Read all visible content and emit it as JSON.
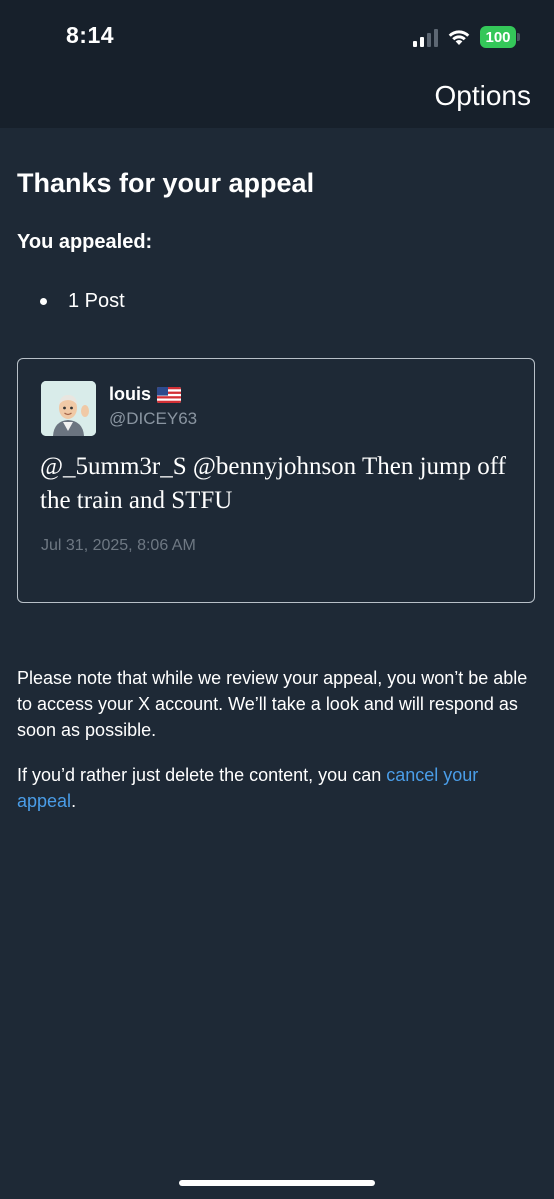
{
  "status_bar": {
    "time": "8:14",
    "battery": "100",
    "battery_color": "#34c759"
  },
  "header": {
    "options_label": "Options"
  },
  "page": {
    "title": "Thanks for your appeal",
    "appealed_label": "You appealed:",
    "appealed_items": [
      "1 Post"
    ]
  },
  "post": {
    "author_name": "louis",
    "author_flag_icon": "us-flag-icon",
    "author_handle": "@DICEY63",
    "text": "@_5umm3r_S @bennyjohnson Then jump off the train and STFU",
    "date": "Jul 31, 2025, 8:06 AM"
  },
  "notice": {
    "text": "Please note that while we review your appeal, you won’t be able to access your X account. We’ll take a look and will respond as soon as possible.",
    "delete_prefix": "If you’d rather just delete the content, you can ",
    "cancel_link": "cancel your appeal",
    "delete_suffix": "."
  },
  "colors": {
    "background": "#1e2936",
    "header_background": "#17202b",
    "link": "#4a9de8",
    "muted": "#8a95a1"
  }
}
